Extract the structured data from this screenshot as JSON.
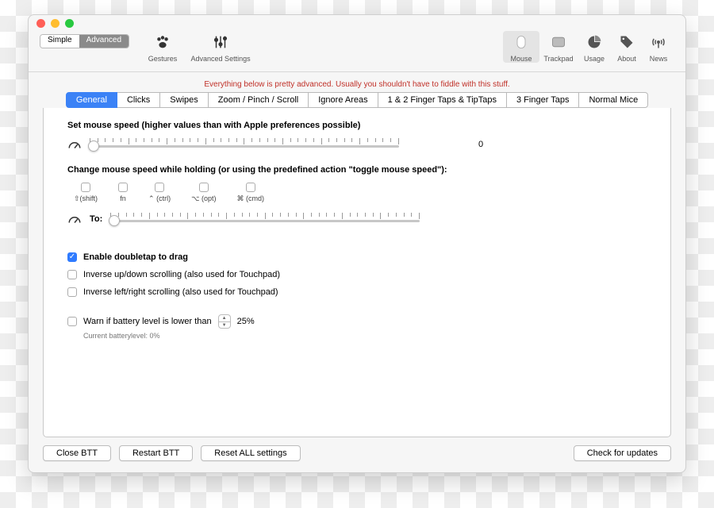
{
  "segmented": {
    "simple": "Simple",
    "advanced": "Advanced"
  },
  "toolbar": {
    "gestures": "Gestures",
    "advanced_settings": "Advanced Settings",
    "mouse": "Mouse",
    "trackpad": "Trackpad",
    "usage": "Usage",
    "about": "About",
    "news": "News"
  },
  "warning": "Everything below is pretty advanced. Usually you shouldn't have to fiddle with this stuff.",
  "tabs": [
    "General",
    "Clicks",
    "Swipes",
    "Zoom / Pinch / Scroll",
    "Ignore Areas",
    "1 & 2 Finger Taps & TipTaps",
    "3 Finger Taps",
    "Normal Mice"
  ],
  "active_tab": "General",
  "speed": {
    "heading": "Set mouse speed (higher values than with Apple preferences possible)",
    "value": "0"
  },
  "modifiers": {
    "heading": "Change mouse speed while holding (or using the predefined action \"toggle mouse speed\"):",
    "items": [
      {
        "label": "⇧(shift)"
      },
      {
        "label": "fn"
      },
      {
        "label": "⌃ (ctrl)"
      },
      {
        "label": "⌥ (opt)"
      },
      {
        "label": "⌘ (cmd)"
      }
    ],
    "to_label": "To:"
  },
  "options": {
    "doubletap": "Enable doubletap to drag",
    "inv_ud": "Inverse up/down scrolling (also used for Touchpad)",
    "inv_lr": "Inverse left/right scrolling (also used for Touchpad)",
    "battery": "Warn if battery level is lower than",
    "battery_pct": "25%",
    "battery_current": "Current batterylevel:  0%"
  },
  "footer": {
    "close": "Close BTT",
    "restart": "Restart BTT",
    "reset": "Reset ALL settings",
    "updates": "Check for updates"
  }
}
